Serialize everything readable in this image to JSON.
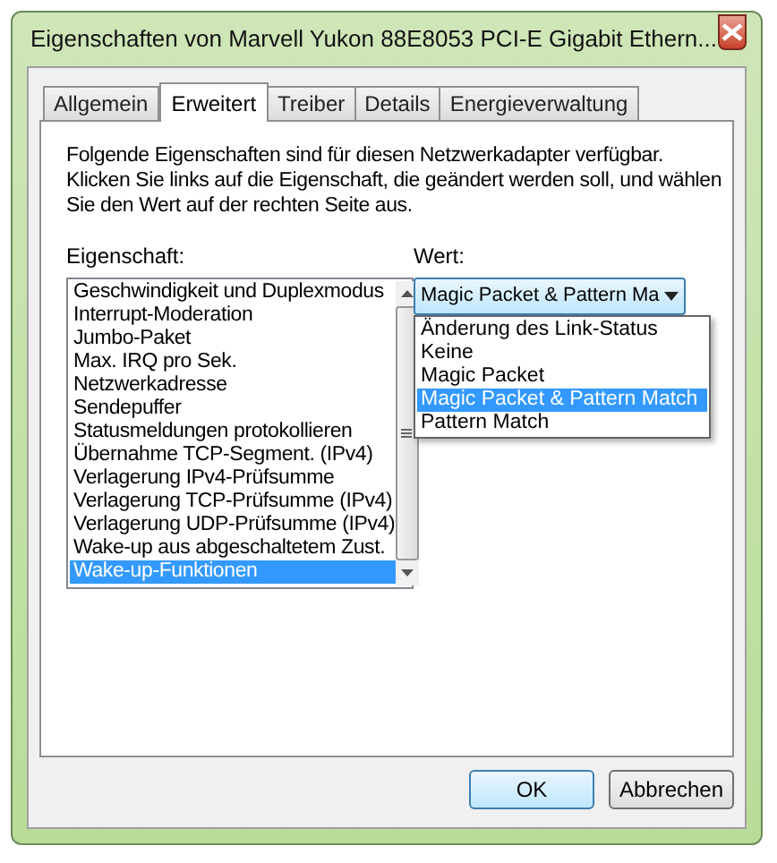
{
  "window": {
    "title": "Eigenschaften von Marvell Yukon 88E8053 PCI-E Gigabit Ethern..."
  },
  "tabs": [
    {
      "label": "Allgemein",
      "selected": false
    },
    {
      "label": "Erweitert",
      "selected": true
    },
    {
      "label": "Treiber",
      "selected": false
    },
    {
      "label": "Details",
      "selected": false
    },
    {
      "label": "Energieverwaltung",
      "selected": false
    }
  ],
  "description": "Folgende Eigenschaften sind für diesen Netzwerkadapter verfügbar. Klicken Sie links auf die Eigenschaft, die geändert werden soll, und wählen Sie den Wert auf der rechten Seite aus.",
  "property_label": "Eigenschaft:",
  "properties": [
    {
      "label": "Geschwindigkeit und Duplexmodus",
      "selected": false
    },
    {
      "label": "Interrupt-Moderation",
      "selected": false
    },
    {
      "label": "Jumbo-Paket",
      "selected": false
    },
    {
      "label": "Max. IRQ pro Sek.",
      "selected": false
    },
    {
      "label": "Netzwerkadresse",
      "selected": false
    },
    {
      "label": "Sendepuffer",
      "selected": false
    },
    {
      "label": "Statusmeldungen protokollieren",
      "selected": false
    },
    {
      "label": "Übernahme TCP-Segment. (IPv4)",
      "selected": false
    },
    {
      "label": "Verlagerung IPv4-Prüfsumme",
      "selected": false
    },
    {
      "label": "Verlagerung TCP-Prüfsumme (IPv4)",
      "selected": false
    },
    {
      "label": "Verlagerung UDP-Prüfsumme (IPv4)",
      "selected": false
    },
    {
      "label": "Wake-up aus abgeschaltetem Zust.",
      "selected": false
    },
    {
      "label": "Wake-up-Funktionen",
      "selected": true
    }
  ],
  "value_label": "Wert:",
  "value_dropdown": {
    "value": "Magic Packet & Pattern Ma",
    "expanded": true
  },
  "value_options": [
    {
      "label": "Änderung des Link-Status",
      "selected": false
    },
    {
      "label": "Keine",
      "selected": false
    },
    {
      "label": "Magic Packet",
      "selected": false
    },
    {
      "label": "Magic Packet & Pattern Match",
      "selected": true
    },
    {
      "label": "Pattern Match",
      "selected": false
    }
  ],
  "buttons": [
    "OK",
    "Abbrechen"
  ]
}
